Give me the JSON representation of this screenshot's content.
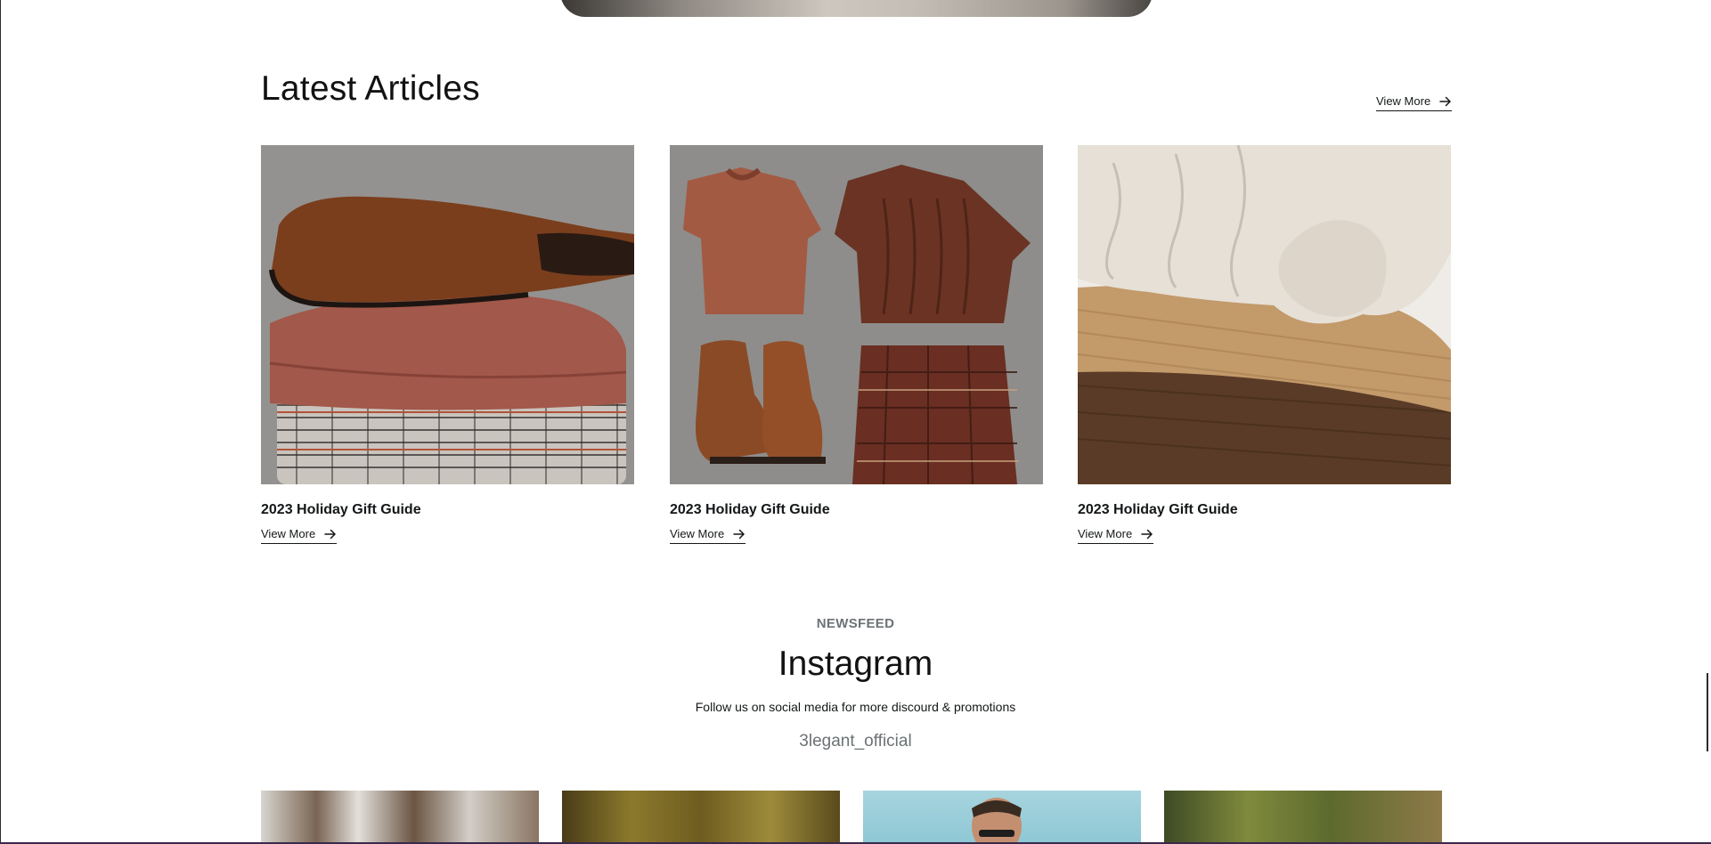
{
  "latest_articles": {
    "title": "Latest Articles",
    "view_more_label": "View More",
    "items": [
      {
        "title": "2023 Holiday Gift Guide",
        "link_label": "View More"
      },
      {
        "title": "2023 Holiday Gift Guide",
        "link_label": "View More"
      },
      {
        "title": "2023 Holiday Gift Guide",
        "link_label": "View More"
      }
    ]
  },
  "newsfeed": {
    "eyebrow": "NEWSFEED",
    "title": "Instagram",
    "subtitle": "Follow us on social media for more discourd & promotions",
    "handle": "3legant_official"
  },
  "icons": {
    "arrow": "arrow-right-icon"
  }
}
